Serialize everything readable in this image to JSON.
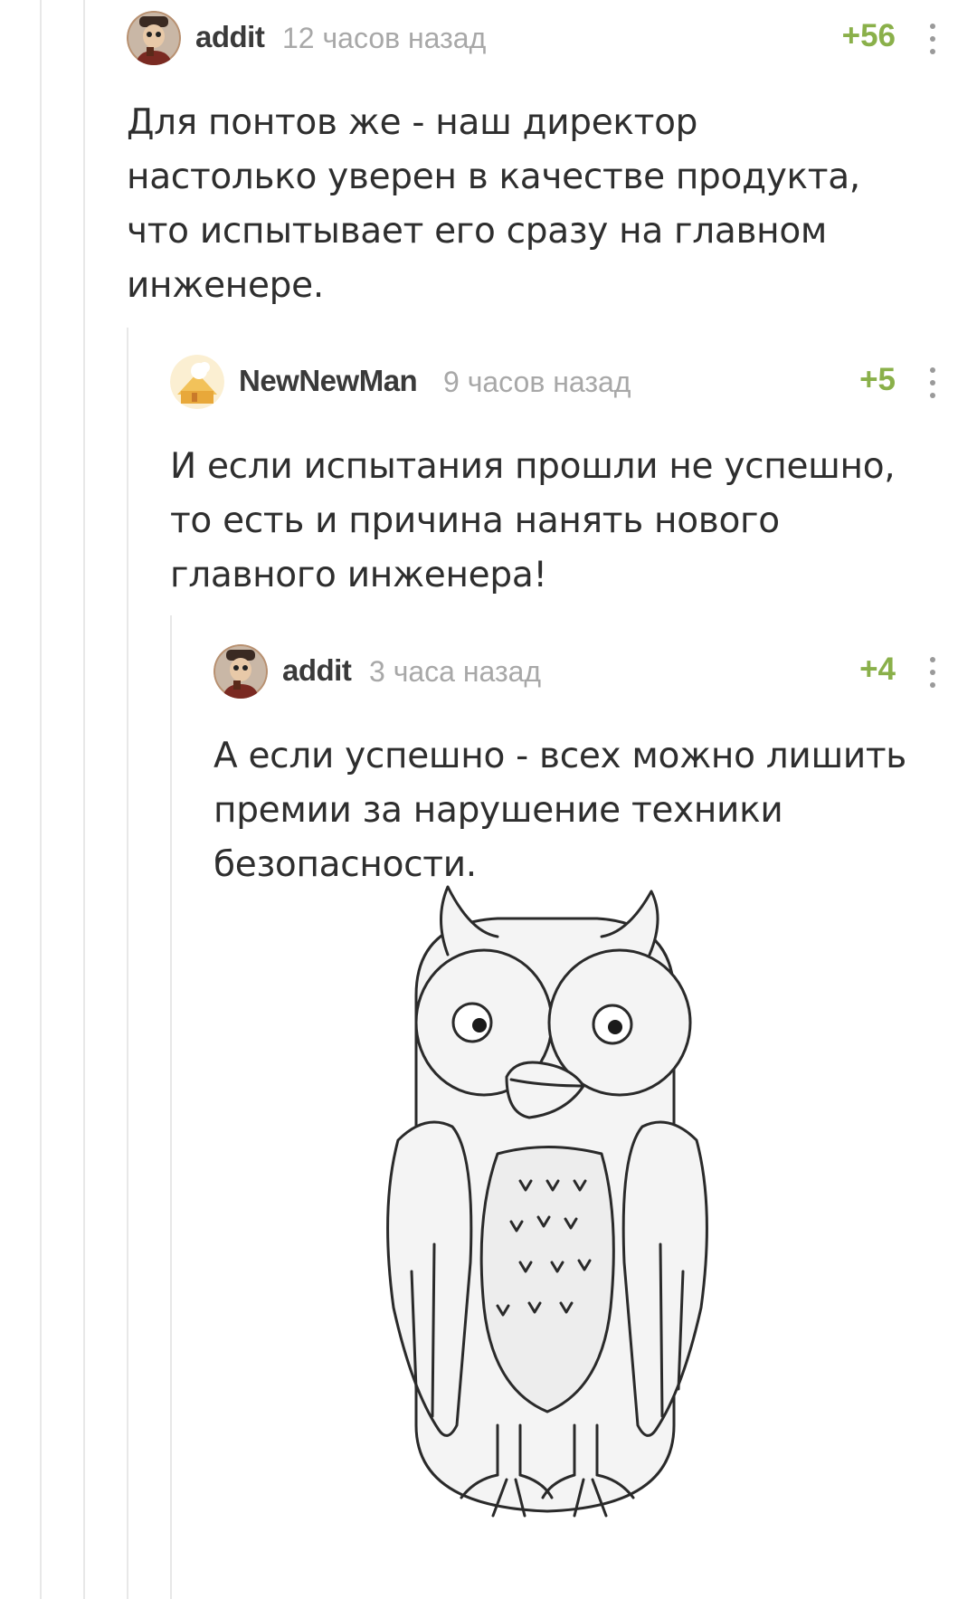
{
  "comments": [
    {
      "username": "addit",
      "time": "12 часов назад",
      "rating": "+56",
      "text": "Для понтов же - наш директор настолько уверен в качестве продукта, что испытывает его сразу на главном инженере.",
      "avatar": "avatar-addit"
    },
    {
      "username": "NewNewMan",
      "time": "9 часов назад",
      "rating": "+5",
      "text": "И если испытания прошли не успешно, то есть и причина нанять нового главного инженера!",
      "avatar": "avatar-newnewman"
    },
    {
      "username": "addit",
      "time": "3 часа назад",
      "rating": "+4",
      "text": "А если успешно - всех можно лишить премии за нарушение техники безопасности.",
      "avatar": "avatar-addit",
      "attachment": "owl-drawing"
    }
  ],
  "icons": {
    "menu": "more-vertical-icon"
  },
  "colors": {
    "rating": "#8ab04a",
    "username": "#3a3a3a",
    "timestamp": "#a8a8a8",
    "thread": "#e8e8e8"
  }
}
